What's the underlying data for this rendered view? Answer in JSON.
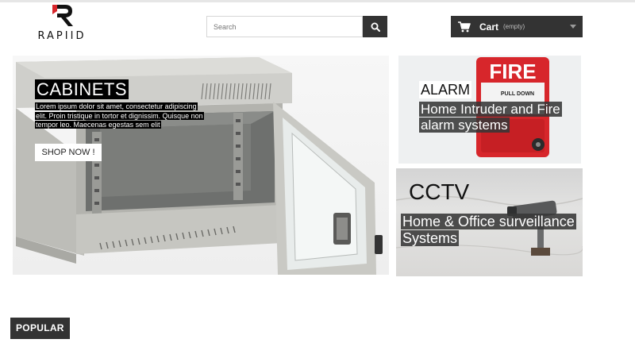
{
  "header": {
    "logo_text": "RAPIID",
    "search": {
      "placeholder": "Search"
    },
    "cart": {
      "label": "Cart",
      "status": "(empty)"
    }
  },
  "hero": {
    "title": "CABINETS",
    "description": "Lorem ipsum dolor sit amet, consectetur adipiscing elit. Proin tristique in tortor et dignissim. Quisque non tempor leo. Maecenas egestas sem elit",
    "button_label": "SHOP NOW !"
  },
  "banners": {
    "alarm": {
      "sign_text": "FIRE",
      "pull_text": "PULL DOWN",
      "title": "ALARM",
      "subtitle": "Home Intruder and Fire alarm systems"
    },
    "cctv": {
      "title": "CCTV",
      "subtitle": "Home & Office surveillance Systems"
    }
  },
  "section": {
    "popular_label": "POPULAR"
  },
  "colors": {
    "dark": "#333333",
    "fire_red": "#d7262b",
    "white": "#ffffff"
  }
}
